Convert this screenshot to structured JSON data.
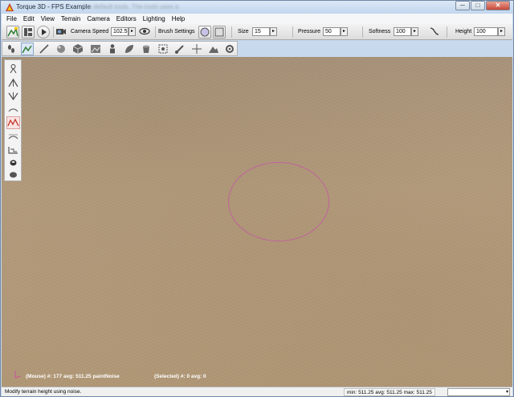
{
  "window": {
    "title": "Torque 3D - FPS Example",
    "title_overlay": "the default tools. The tools uses a",
    "buttons": {
      "minimize": "─",
      "maximize": "□",
      "close": "✕"
    }
  },
  "menubar": {
    "items": [
      {
        "label": "File"
      },
      {
        "label": "Edit"
      },
      {
        "label": "View"
      },
      {
        "label": "Terrain"
      },
      {
        "label": "Camera"
      },
      {
        "label": "Editors"
      },
      {
        "label": "Lighting"
      },
      {
        "label": "Help"
      }
    ]
  },
  "toolbar": {
    "camera_speed_label": "Camera Speed",
    "camera_speed_value": "102.5",
    "brush_settings_label": "Brush Settings",
    "size_label": "Size",
    "size_value": "15",
    "pressure_label": "Pressure",
    "pressure_value": "50",
    "softness_label": "Softness",
    "softness_value": "100",
    "height_label": "Height",
    "height_value": "100",
    "arrow_glyph": "▸"
  },
  "viewport": {
    "mouse_readout": "(Mouse) #: 177  avg: 511.25 paintNoise",
    "selected_readout": "(Selected) #: 0  avg: 0"
  },
  "statusbar": {
    "message": "Modify terrain height using noise.",
    "stats": "min: 511.25  avg: 511.25  max: 511.25",
    "dropdown_glyph": "▾"
  },
  "colors": {
    "brush_outline": "#c0629c",
    "terrain": "#ae9576",
    "window_frame": "#c7d9ec"
  }
}
